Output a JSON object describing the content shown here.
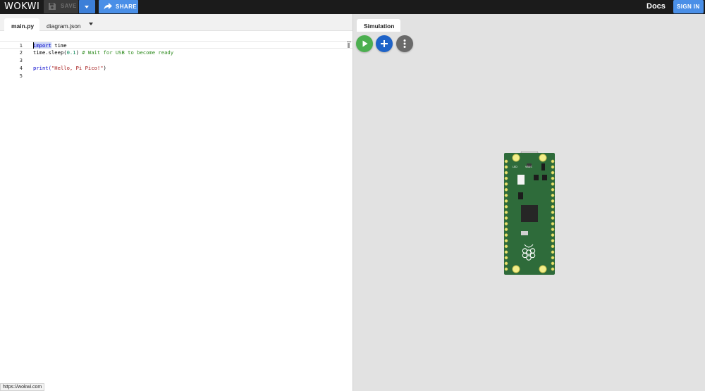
{
  "app": {
    "logo_text": "WOKWI"
  },
  "toolbar": {
    "save_label": "SAVE",
    "share_label": "SHARE",
    "docs_label": "Docs",
    "signin_label": "SIGN IN"
  },
  "editor": {
    "tabs": [
      {
        "label": "main.py",
        "active": true
      },
      {
        "label": "diagram.json",
        "active": false
      }
    ],
    "lines": [
      {
        "number": "1"
      },
      {
        "number": "2"
      },
      {
        "number": "3"
      },
      {
        "number": "4"
      },
      {
        "number": "5"
      }
    ],
    "code": {
      "line1_keyword": "import",
      "line1_rest": " time",
      "line2_call": "time.sleep(",
      "line2_arg": "0.1",
      "line2_close": ") ",
      "line2_comment": "# Wait for USB to become ready",
      "line4_call": "print(",
      "line4_string": "\"Hello, Pi Pico!\"",
      "line4_close": ")"
    }
  },
  "simulation": {
    "tab_label": "Simulation",
    "buttons": [
      {
        "name": "play",
        "icon": "play-icon",
        "color": "#4caf50"
      },
      {
        "name": "add",
        "icon": "plus-icon",
        "color": "#1e63c8"
      },
      {
        "name": "more",
        "icon": "vertical-dots-icon",
        "color": "#6a6a6a"
      }
    ],
    "board": {
      "label_left": "LED",
      "label_right": "VBUS",
      "color": "#2e6b3a"
    }
  },
  "status": {
    "hover_url": "https://wokwi.com"
  },
  "colors": {
    "topbar": "#1b1b1b",
    "accent": "#4a8fe7"
  }
}
